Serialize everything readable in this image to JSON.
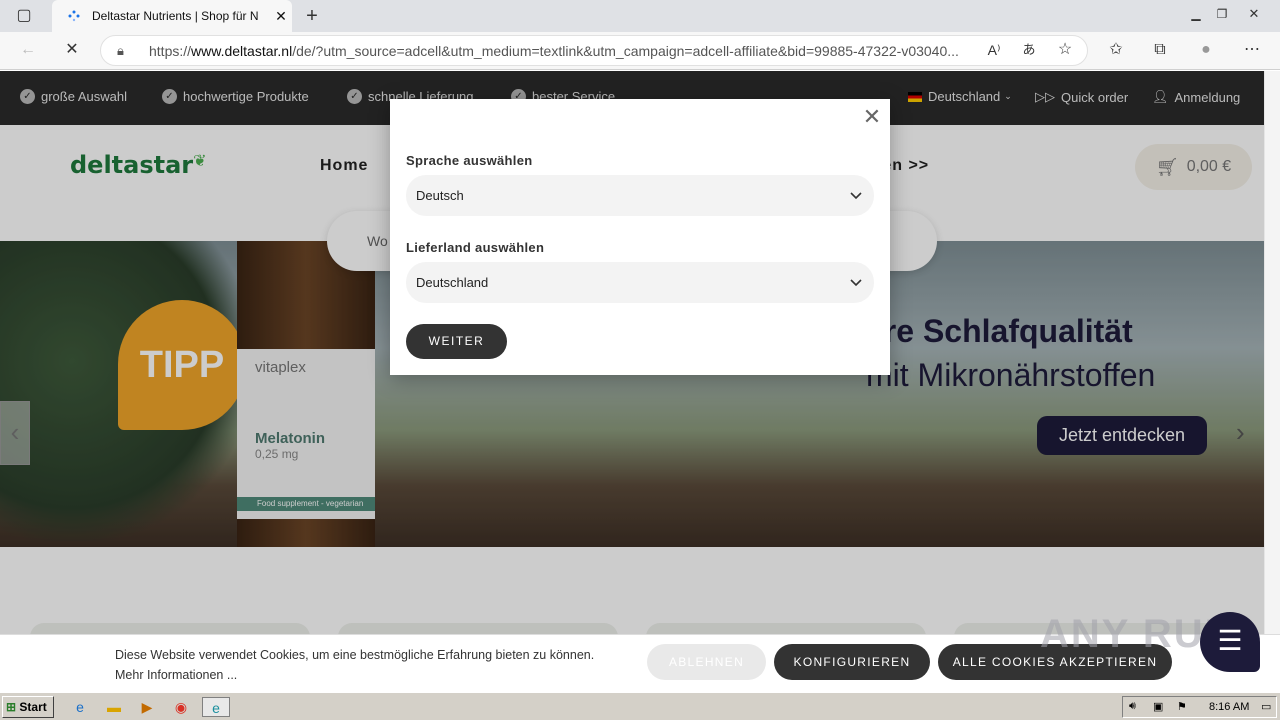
{
  "browser": {
    "tab_title": "Deltastar Nutrients | Shop für N",
    "url_prefix": "https://",
    "url_domain": "www.deltastar.nl",
    "url_rest": "/de/?utm_source=adcell&utm_medium=textlink&utm_campaign=adcell-affiliate&bid=99885-47322-v03040..."
  },
  "topstrip": {
    "usps": [
      "große Auswahl",
      "hochwertige Produkte",
      "schnelle Lieferung",
      "bester Service"
    ],
    "country": "Deutschland",
    "quick_order": "Quick order",
    "login": "Anmeldung"
  },
  "header": {
    "logo": "deltastar",
    "nav_home": "Home",
    "nav_more": "ten >>",
    "cart_total": "0,00 €",
    "search_placeholder": "Wo"
  },
  "hero": {
    "badge": "TIPP",
    "bottle_brand": "vitaplex",
    "bottle_product": "Melatonin",
    "bottle_dose": "0,25 mg",
    "bottle_band": "Food supplement - vegetarian",
    "headline": "ere Schlafqualität",
    "subline": "mit Mikronährstoffen",
    "cta": "Jetzt entdecken"
  },
  "modal": {
    "language_label": "Sprache auswählen",
    "language_value": "Deutsch",
    "country_label": "Lieferland auswählen",
    "country_value": "Deutschland",
    "continue": "WEITER"
  },
  "cookie": {
    "text": "Diese Website verwendet Cookies, um eine bestmögliche Erfahrung bieten zu können. Mehr Informationen ...",
    "reject": "ABLEHNEN",
    "configure": "KONFIGURIEREN",
    "accept_all": "ALLE COOKIES AKZEPTIEREN"
  },
  "watermark": "ANY RUN",
  "taskbar": {
    "start": "Start",
    "clock": "8:16 AM"
  },
  "colors": {
    "dark": "#2b2b2b",
    "brand_green": "#1e7a3d",
    "navy": "#1d1b3a",
    "tipp_orange": "#f0a52a"
  }
}
